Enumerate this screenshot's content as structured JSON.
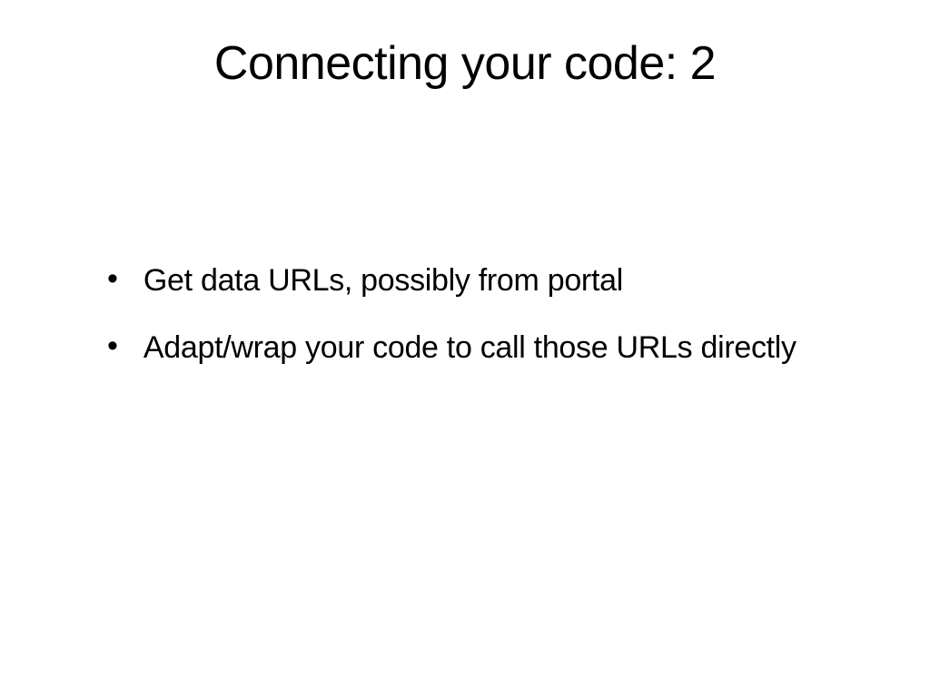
{
  "slide": {
    "title": "Connecting your code: 2",
    "bullets": [
      "Get data URLs, possibly from portal",
      "Adapt/wrap your code to call those URLs directly"
    ]
  }
}
